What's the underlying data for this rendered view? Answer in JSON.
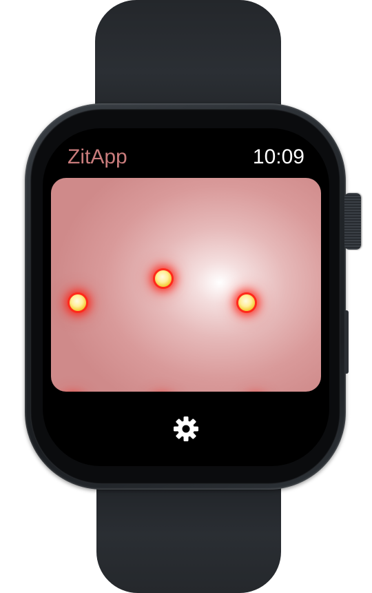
{
  "app": {
    "title": "ZitApp",
    "time": "10:09"
  },
  "skin": {
    "zits": [
      {
        "id": "zit-1",
        "state": "active"
      },
      {
        "id": "zit-2",
        "state": "active"
      },
      {
        "id": "zit-3",
        "state": "active"
      },
      {
        "id": "zit-4",
        "state": "active"
      },
      {
        "id": "zit-5",
        "state": "active"
      },
      {
        "id": "zit-6",
        "state": "popping"
      }
    ]
  },
  "footer": {
    "settings_icon": "gear-icon"
  },
  "colors": {
    "title": "#c97c7c",
    "clock": "#ffffff",
    "zit_glow": "#ff2a1a",
    "zit_core": "#ffef9a"
  }
}
